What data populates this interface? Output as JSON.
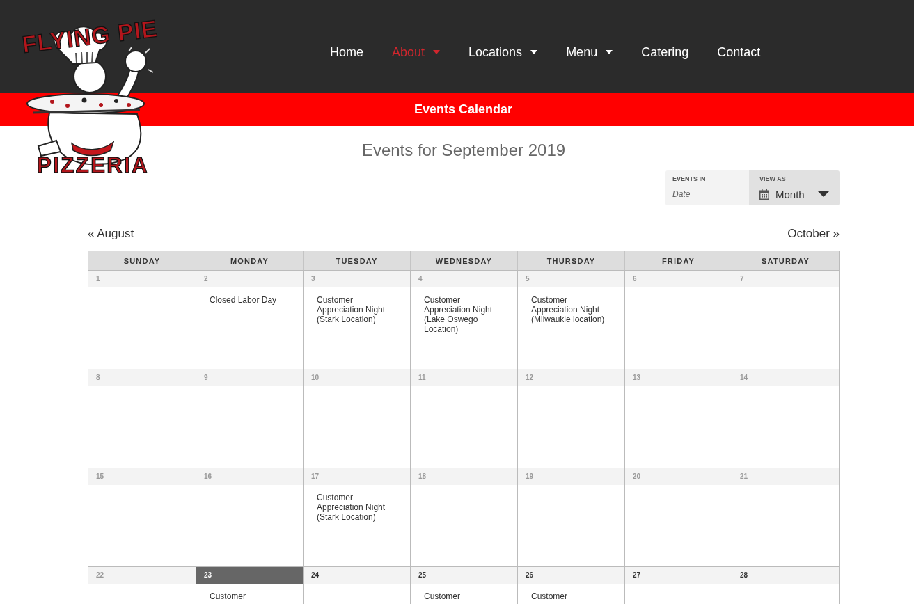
{
  "header": {
    "logo": {
      "top_text": "FLYING PIE",
      "bottom_text": "PIZZERIA"
    },
    "nav": [
      {
        "label": "Home",
        "selected": false,
        "dropdown": false
      },
      {
        "label": "About",
        "selected": true,
        "dropdown": true
      },
      {
        "label": "Locations",
        "selected": false,
        "dropdown": true
      },
      {
        "label": "Menu",
        "selected": false,
        "dropdown": true
      },
      {
        "label": "Catering",
        "selected": false,
        "dropdown": false
      },
      {
        "label": "Contact",
        "selected": false,
        "dropdown": false
      }
    ]
  },
  "banner": {
    "title": "Events Calendar"
  },
  "page_title": "Events for September 2019",
  "filter_bar": {
    "events_in": {
      "label": "EVENTS IN",
      "placeholder": "Date"
    },
    "view_as": {
      "label": "VIEW AS",
      "value": "Month"
    }
  },
  "month_nav": {
    "previous": "« August",
    "next": "October »"
  },
  "calendar": {
    "weekdays": [
      "SUNDAY",
      "MONDAY",
      "TUESDAY",
      "WEDNESDAY",
      "THURSDAY",
      "FRIDAY",
      "SATURDAY"
    ],
    "weeks": [
      [
        {
          "day": "1",
          "past": true,
          "today": false
        },
        {
          "day": "2",
          "past": true,
          "today": false,
          "events": [
            "Closed Labor Day"
          ]
        },
        {
          "day": "3",
          "past": true,
          "today": false,
          "events": [
            "Customer Appreciation Night (Stark Location)"
          ]
        },
        {
          "day": "4",
          "past": true,
          "today": false,
          "events": [
            "Customer Appreciation Night (Lake Oswego Location)"
          ]
        },
        {
          "day": "5",
          "past": true,
          "today": false,
          "events": [
            "Customer Appreciation Night (Milwaukie location)"
          ]
        },
        {
          "day": "6",
          "past": true,
          "today": false
        },
        {
          "day": "7",
          "past": true,
          "today": false
        }
      ],
      [
        {
          "day": "8",
          "past": true,
          "today": false
        },
        {
          "day": "9",
          "past": true,
          "today": false
        },
        {
          "day": "10",
          "past": true,
          "today": false
        },
        {
          "day": "11",
          "past": true,
          "today": false
        },
        {
          "day": "12",
          "past": true,
          "today": false
        },
        {
          "day": "13",
          "past": true,
          "today": false
        },
        {
          "day": "14",
          "past": true,
          "today": false
        }
      ],
      [
        {
          "day": "15",
          "past": true,
          "today": false
        },
        {
          "day": "16",
          "past": true,
          "today": false
        },
        {
          "day": "17",
          "past": true,
          "today": false,
          "events": [
            "Customer Appreciation Night (Stark Location)"
          ]
        },
        {
          "day": "18",
          "past": true,
          "today": false
        },
        {
          "day": "19",
          "past": true,
          "today": false
        },
        {
          "day": "20",
          "past": true,
          "today": false
        },
        {
          "day": "21",
          "past": true,
          "today": false
        }
      ],
      [
        {
          "day": "22",
          "past": true,
          "today": false
        },
        {
          "day": "23",
          "past": false,
          "today": true,
          "events": [
            "Customer"
          ]
        },
        {
          "day": "24",
          "past": false,
          "today": false
        },
        {
          "day": "25",
          "past": false,
          "today": false,
          "events": [
            "Customer"
          ]
        },
        {
          "day": "26",
          "past": false,
          "today": false,
          "events": [
            "Customer"
          ]
        },
        {
          "day": "27",
          "past": false,
          "today": false
        },
        {
          "day": "28",
          "past": false,
          "today": false
        }
      ]
    ]
  }
}
